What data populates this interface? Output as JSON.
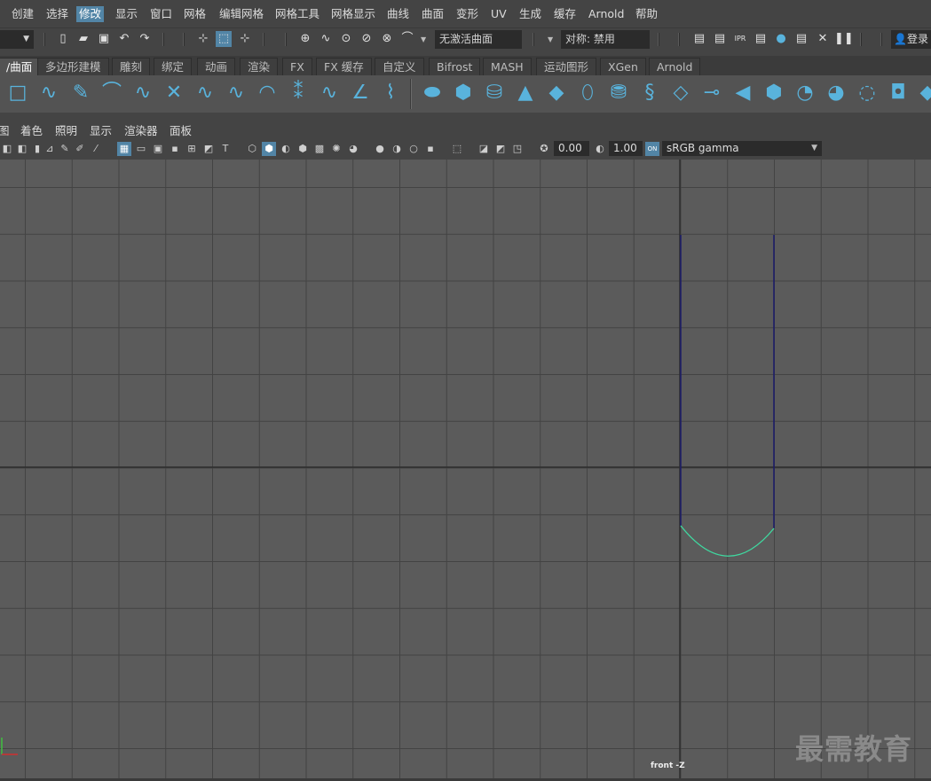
{
  "menubar": {
    "items": [
      "创建",
      "选择",
      "修改",
      "显示",
      "窗口",
      "网格",
      "编辑网格",
      "网格工具",
      "网格显示",
      "曲线",
      "曲面",
      "变形",
      "UV",
      "生成",
      "缓存",
      "Arnold",
      "帮助"
    ],
    "active_index": 2
  },
  "statusline": {
    "curve_field": "无激活曲面",
    "symmetry_field": "对称: 禁用",
    "login_label": "登录"
  },
  "shelf": {
    "tabs": [
      "/曲面",
      "多边形建模",
      "雕刻",
      "绑定",
      "动画",
      "渲染",
      "FX",
      "FX 缓存",
      "自定义",
      "Bifrost",
      "MASH",
      "运动图形",
      "XGen",
      "Arnold"
    ],
    "active_index": 0
  },
  "panel_menu": {
    "items": [
      "图",
      "着色",
      "照明",
      "显示",
      "渲染器",
      "面板"
    ]
  },
  "panel_toolbar": {
    "exposure_value": "0.00",
    "gamma_value": "1.00",
    "color_space": "sRGB gamma"
  },
  "viewport": {
    "camera_label": "front -Z",
    "watermark": "最需教育",
    "curve_color": "#3fd9a0",
    "line_color": "#1b1b6a"
  }
}
